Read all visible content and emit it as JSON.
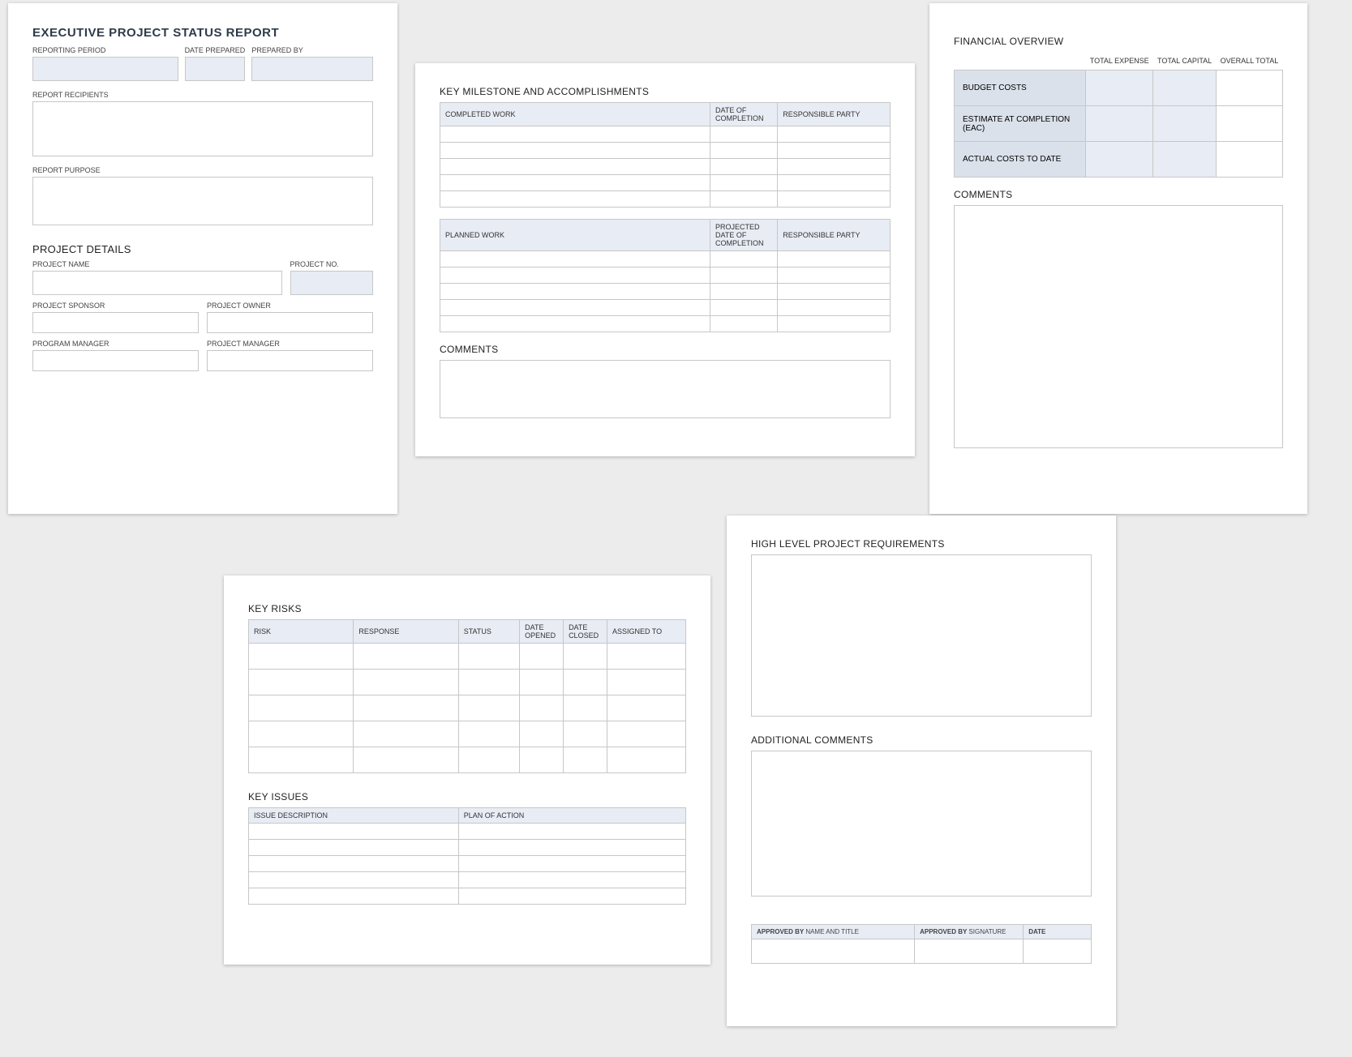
{
  "card1": {
    "title": "EXECUTIVE PROJECT STATUS REPORT",
    "labels": {
      "reporting_period": "REPORTING PERIOD",
      "date_prepared": "DATE PREPARED",
      "prepared_by": "PREPARED BY",
      "report_recipients": "REPORT RECIPIENTS",
      "report_purpose": "REPORT PURPOSE",
      "project_details": "PROJECT DETAILS",
      "project_name": "PROJECT NAME",
      "project_no": "PROJECT NO.",
      "project_sponsor": "PROJECT SPONSOR",
      "project_owner": "PROJECT OWNER",
      "program_manager": "PROGRAM MANAGER",
      "project_manager": "PROJECT MANAGER"
    }
  },
  "card2": {
    "heading": "KEY MILESTONE AND ACCOMPLISHMENTS",
    "completed": {
      "col_work": "COMPLETED WORK",
      "col_date": "DATE OF COMPLETION",
      "col_party": "RESPONSIBLE PARTY"
    },
    "planned": {
      "col_work": "PLANNED WORK",
      "col_date": "PROJECTED DATE OF COMPLETION",
      "col_party": "RESPONSIBLE PARTY"
    },
    "comments": "COMMENTS"
  },
  "card3": {
    "heading": "FINANCIAL OVERVIEW",
    "cols": {
      "total_expense": "TOTAL EXPENSE",
      "total_capital": "TOTAL CAPITAL",
      "overall_total": "OVERALL TOTAL"
    },
    "rows": {
      "budget": "BUDGET COSTS",
      "eac": "ESTIMATE AT COMPLETION (EAC)",
      "actual": "ACTUAL COSTS TO DATE"
    },
    "comments": "COMMENTS"
  },
  "card4": {
    "risks_heading": "KEY RISKS",
    "risks_cols": {
      "risk": "RISK",
      "response": "RESPONSE",
      "status": "STATUS",
      "date_opened": "DATE OPENED",
      "date_closed": "DATE CLOSED",
      "assigned_to": "ASSIGNED TO"
    },
    "issues_heading": "KEY ISSUES",
    "issues_cols": {
      "desc": "ISSUE DESCRIPTION",
      "plan": "PLAN OF ACTION"
    }
  },
  "card5": {
    "req_heading": "HIGH LEVEL PROJECT REQUIREMENTS",
    "addl_heading": "ADDITIONAL COMMENTS",
    "approved_name_prefix": "APPROVED BY ",
    "approved_name_suffix": "NAME AND TITLE",
    "approved_sig_prefix": "APPROVED BY ",
    "approved_sig_suffix": "SIGNATURE",
    "approved_date": "DATE"
  }
}
